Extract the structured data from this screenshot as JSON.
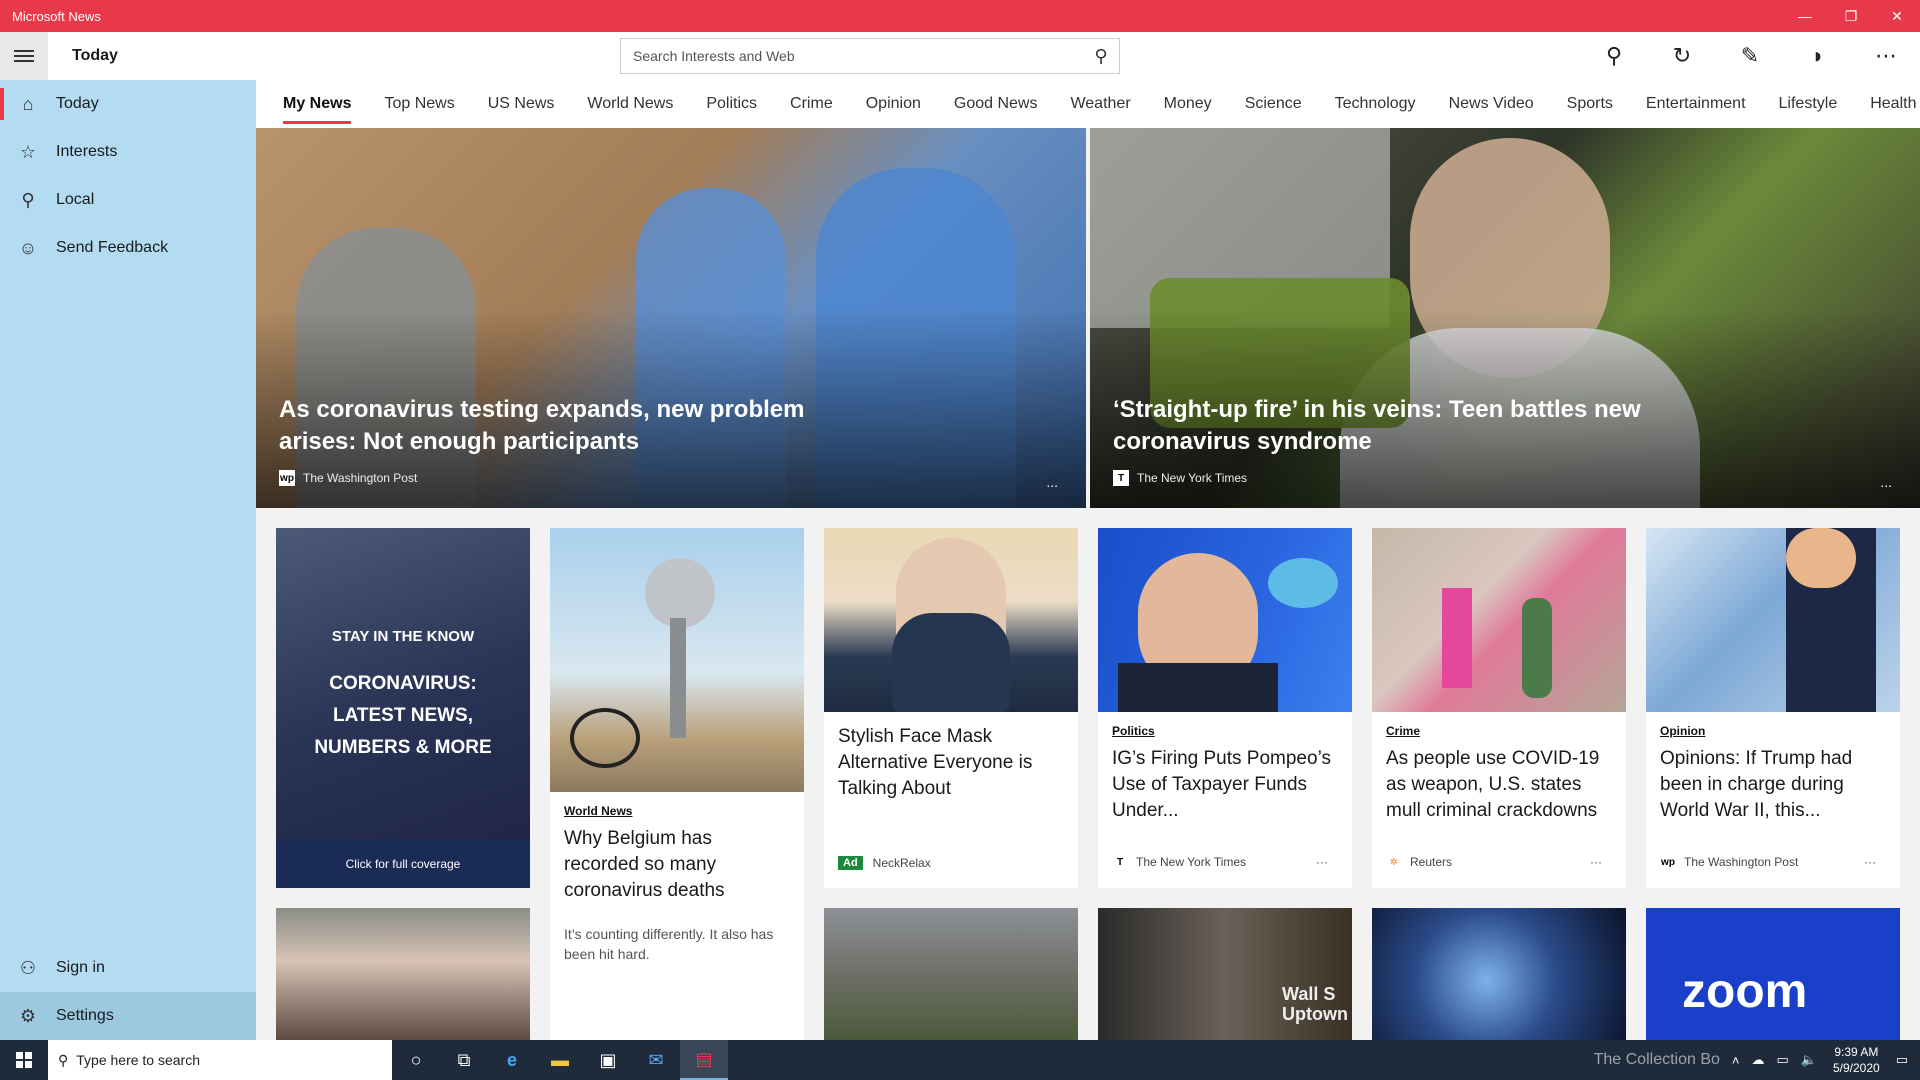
{
  "window": {
    "title": "Microsoft News",
    "minimize": "—",
    "restore": "❐",
    "close": "✕"
  },
  "header": {
    "page_title": "Today",
    "search_placeholder": "Search Interests and Web",
    "icons": [
      "pin-icon",
      "refresh-icon",
      "edit-icon",
      "dark-mode-icon",
      "more-icon"
    ]
  },
  "sidebar": {
    "items": [
      {
        "label": "Today",
        "icon": "⌂"
      },
      {
        "label": "Interests",
        "icon": "☆"
      },
      {
        "label": "Local",
        "icon": "⚲"
      },
      {
        "label": "Send Feedback",
        "icon": "☺"
      }
    ],
    "bottom": [
      {
        "label": "Sign in",
        "icon": "⚇"
      },
      {
        "label": "Settings",
        "icon": "⚙"
      }
    ]
  },
  "tabs": [
    "My News",
    "Top News",
    "US News",
    "World News",
    "Politics",
    "Crime",
    "Opinion",
    "Good News",
    "Weather",
    "Money",
    "Science",
    "Technology",
    "News Video",
    "Sports",
    "Entertainment",
    "Lifestyle",
    "Health and Fitness"
  ],
  "hero": [
    {
      "title": "As coronavirus testing expands, new problem arises: Not enough participants",
      "source": "The Washington Post",
      "logo": "wp",
      "more": "..."
    },
    {
      "title": "‘Straight-up fire’ in his veins: Teen battles new coronavirus syndrome",
      "source": "The New York Times",
      "logo": "T",
      "more": "..."
    }
  ],
  "promo": {
    "kicker": "STAY IN THE KNOW",
    "headline_1": "CORONAVIRUS:",
    "headline_2": "LATEST NEWS,",
    "headline_3": "NUMBERS & MORE",
    "cta": "Click for full coverage"
  },
  "cards": [
    {
      "category": "World News",
      "title": "Why Belgium has recorded so many coronavirus deaths",
      "summary": "It’s counting differently. It also has been hit hard."
    },
    {
      "category": "",
      "title": "Stylish Face Mask Alternative Everyone is Talking About",
      "ad": "Ad",
      "source": "NeckRelax"
    },
    {
      "category": "Politics",
      "title": "IG’s Firing Puts Pompeo’s Use of Taxpayer Funds Under...",
      "source": "The New York Times",
      "logo": "T",
      "more": "···"
    },
    {
      "category": "Crime",
      "title": "As people use COVID-19 as weapon, U.S. states mull criminal crackdowns",
      "source": "Reuters",
      "logo": "✲",
      "more": "···"
    },
    {
      "category": "Opinion",
      "title": "Opinions: If Trump had been in charge during World War II, this...",
      "source": "The Washington Post",
      "logo": "wp",
      "more": "···"
    }
  ],
  "lower_cards": [
    {
      "overlay": ""
    },
    {
      "overlay": ""
    },
    {
      "overlay": "Wall S Uptown"
    },
    {
      "overlay": ""
    },
    {
      "overlay": "zoom"
    }
  ],
  "taskbar": {
    "search_placeholder": "Type here to search",
    "time": "9:39 AM",
    "date": "5/9/2020",
    "watermark": "The Collection Bo"
  },
  "colors": {
    "accent": "#e8394a",
    "sidebar": "#b3dbf2",
    "taskbar": "#1f2b3a"
  }
}
